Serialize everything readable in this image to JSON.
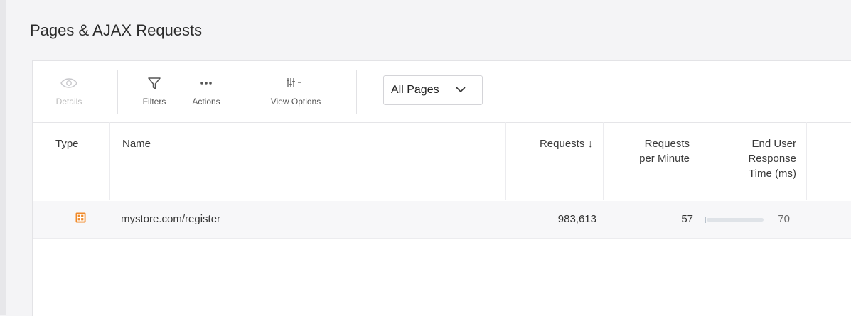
{
  "page": {
    "title": "Pages & AJAX Requests"
  },
  "toolbar": {
    "details_label": "Details",
    "filters_label": "Filters",
    "actions_label": "Actions",
    "view_options_label": "View Options",
    "page_filter": {
      "selected": "All Pages"
    }
  },
  "table": {
    "columns": {
      "type": "Type",
      "name": "Name",
      "requests": "Requests ↓",
      "rpm_line1": "Requests",
      "rpm_line2": "per Minute",
      "eurt_line1": "End User",
      "eurt_line2": "Response",
      "eurt_line3": "Time (ms)"
    },
    "rows": [
      {
        "type_icon": "page-icon",
        "name": "mystore.com/register",
        "requests": "983,613",
        "requests_per_minute": "57",
        "end_user_response_time": "70",
        "response_bar_fraction": 0.04
      }
    ]
  },
  "colors": {
    "page_icon": "#f08a2a",
    "bar_track": "#dfe3e8"
  }
}
